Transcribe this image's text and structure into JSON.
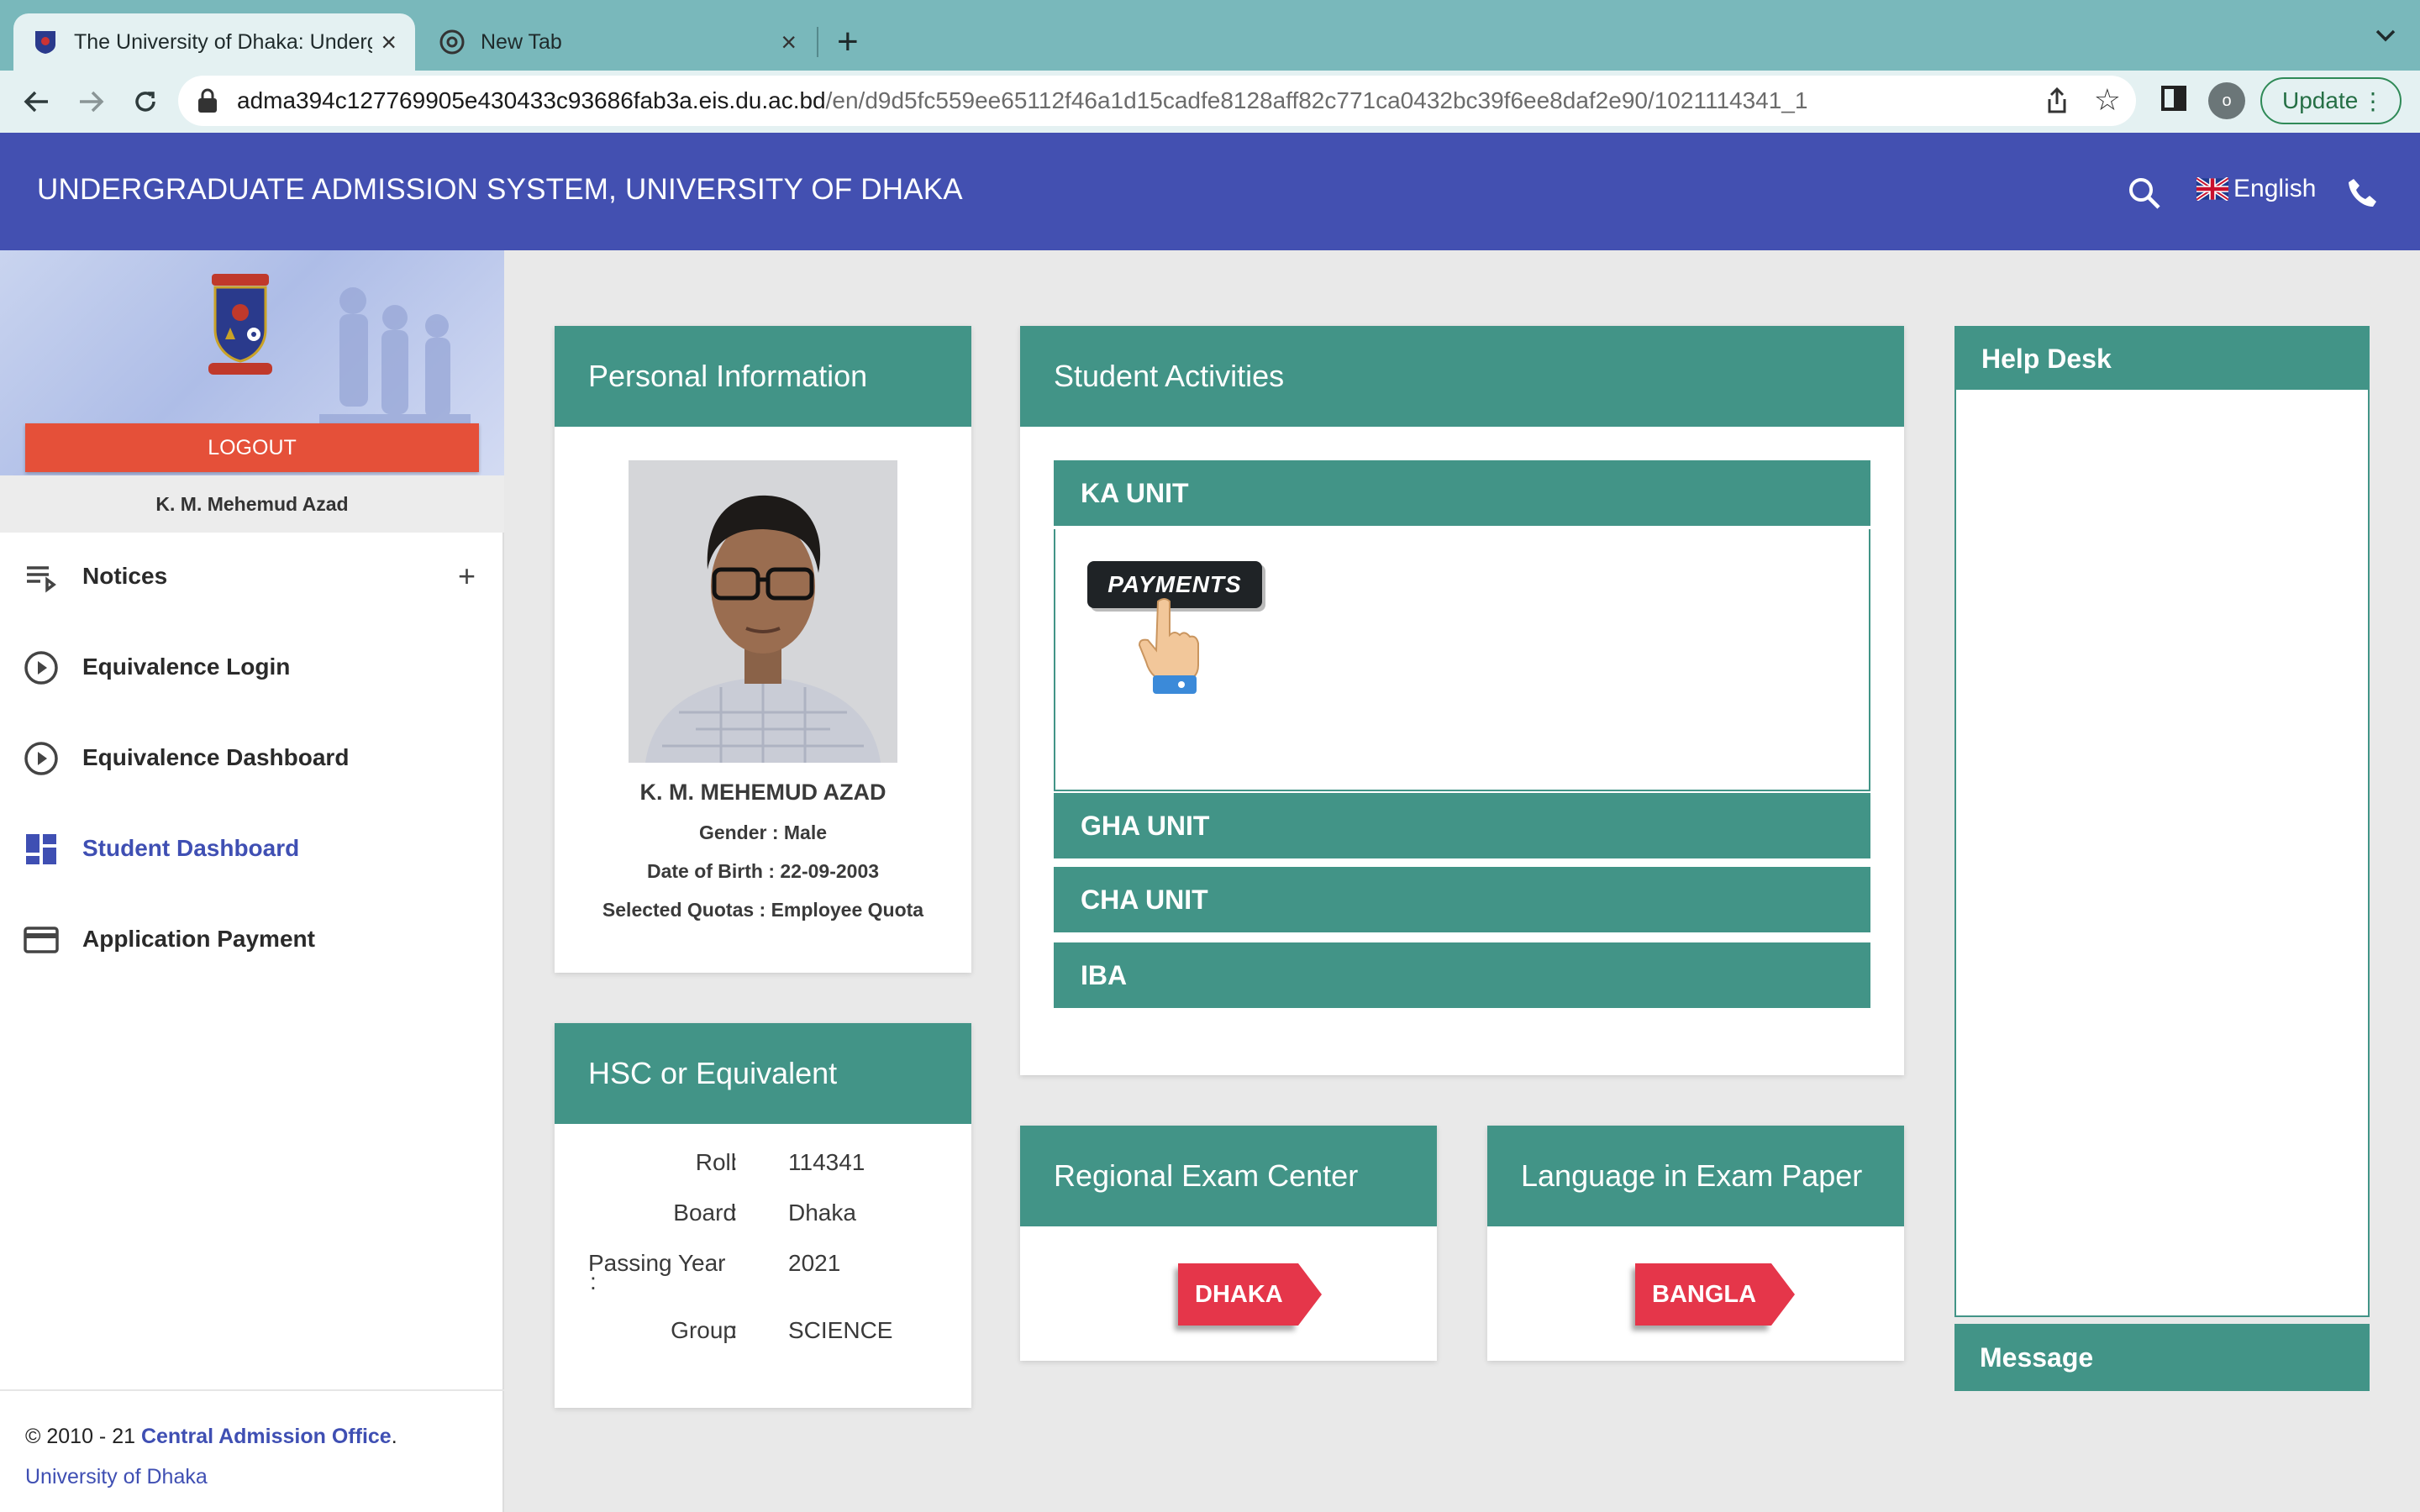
{
  "browser": {
    "tabs": [
      {
        "title": "The University of Dhaka: Undergraduate Admission System",
        "active": true
      },
      {
        "title": "New Tab",
        "active": false
      }
    ],
    "url_host": "adma394c127769905e430433c93686fab3a.eis.du.ac.bd",
    "url_path": "/en/d9d5fc559ee65112f46a1d15cadfe8128aff82c771ca0432bc39f6ee8daf2e90/1021114341_1",
    "profile_initial": "o",
    "update_label": "Update"
  },
  "header": {
    "title": "UNDERGRADUATE ADMISSION SYSTEM, UNIVERSITY OF DHAKA",
    "language": "English"
  },
  "sidebar": {
    "logout_label": "LOGOUT",
    "user_name": "K. M. Mehemud Azad",
    "items": [
      {
        "label": "Notices",
        "icon": "list-icon"
      },
      {
        "label": "Equivalence Login",
        "icon": "play-circle-icon"
      },
      {
        "label": "Equivalence Dashboard",
        "icon": "play-circle-icon"
      },
      {
        "label": "Student Dashboard",
        "icon": "dashboard-icon",
        "active": true
      },
      {
        "label": "Application Payment",
        "icon": "credit-card-icon"
      }
    ],
    "footer": {
      "copyright": "© 2010 - 21 ",
      "office": "Central Admission Office",
      "period": ".",
      "university": "University of Dhaka"
    }
  },
  "personal": {
    "heading": "Personal Information",
    "name": "K. M. MEHEMUD AZAD",
    "gender": "Gender : Male",
    "dob": "Date of Birth : 22-09-2003",
    "quota": "Selected Quotas : Employee Quota"
  },
  "hsc": {
    "heading": "HSC or Equivalent",
    "rows": [
      {
        "label": "Roll",
        "value": "114341"
      },
      {
        "label": "Board",
        "value": "Dhaka"
      },
      {
        "label": "Passing Year",
        "value": "2021"
      },
      {
        "label": "Group",
        "value": "SCIENCE"
      }
    ]
  },
  "activities": {
    "heading": "Student Activities",
    "units": [
      "KA UNIT",
      "GHA UNIT",
      "CHA UNIT",
      "IBA"
    ],
    "payments_label": "PAYMENTS"
  },
  "regional": {
    "heading": "Regional Exam Center",
    "value": "DHAKA"
  },
  "language": {
    "heading": "Language in Exam Paper",
    "value": "BANGLA"
  },
  "helpdesk": {
    "heading": "Help Desk",
    "message_label": "Message"
  },
  "colors": {
    "appbar": "#4350b1",
    "teal": "#429487",
    "logout": "#e55039",
    "tag": "#e5364a",
    "tabbar": "#79b8bb"
  }
}
